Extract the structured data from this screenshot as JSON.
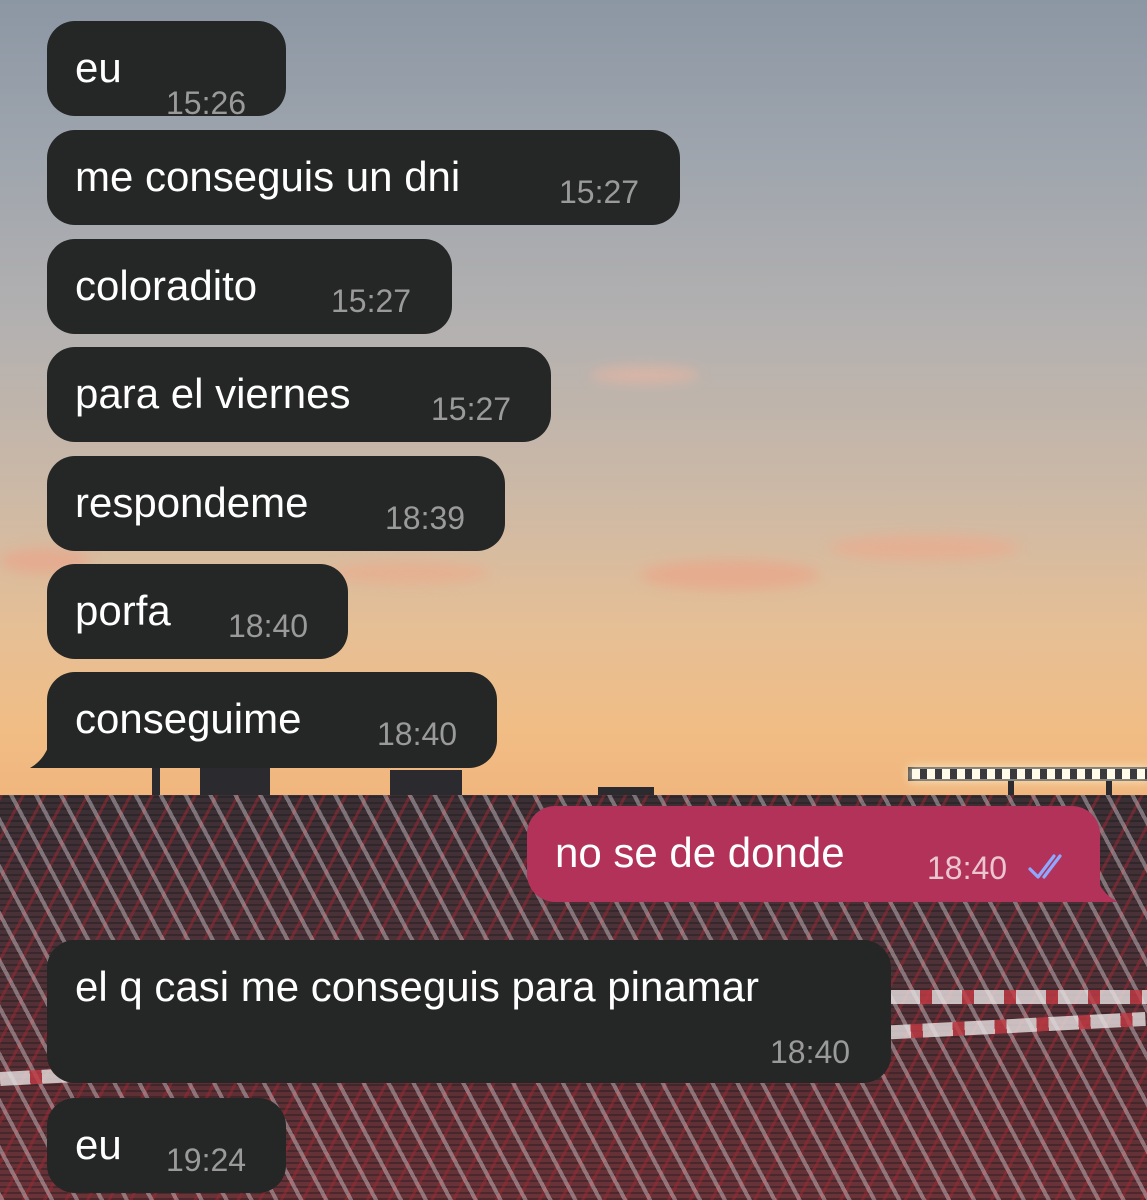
{
  "messages": [
    {
      "text": "eu",
      "time": "15:26",
      "direction": "in"
    },
    {
      "text": "me conseguis un dni",
      "time": "15:27",
      "direction": "in"
    },
    {
      "text": "coloradito",
      "time": "15:27",
      "direction": "in"
    },
    {
      "text": "para el viernes",
      "time": "15:27",
      "direction": "in"
    },
    {
      "text": "respondeme",
      "time": "18:39",
      "direction": "in"
    },
    {
      "text": "porfa",
      "time": "18:40",
      "direction": "in"
    },
    {
      "text": "conseguime",
      "time": "18:40",
      "direction": "in"
    },
    {
      "text": "no se de donde",
      "time": "18:40",
      "direction": "out",
      "status": "read"
    },
    {
      "text": "el q casi me conseguis para pinamar",
      "time": "18:40",
      "direction": "in"
    },
    {
      "text": "eu",
      "time": "19:24",
      "direction": "in"
    }
  ],
  "colors": {
    "incoming_bubble": "#252626",
    "outgoing_bubble": "#b2325a",
    "read_checks": "#8fa8ff"
  },
  "icons": {
    "read_status": "double-check-icon"
  }
}
